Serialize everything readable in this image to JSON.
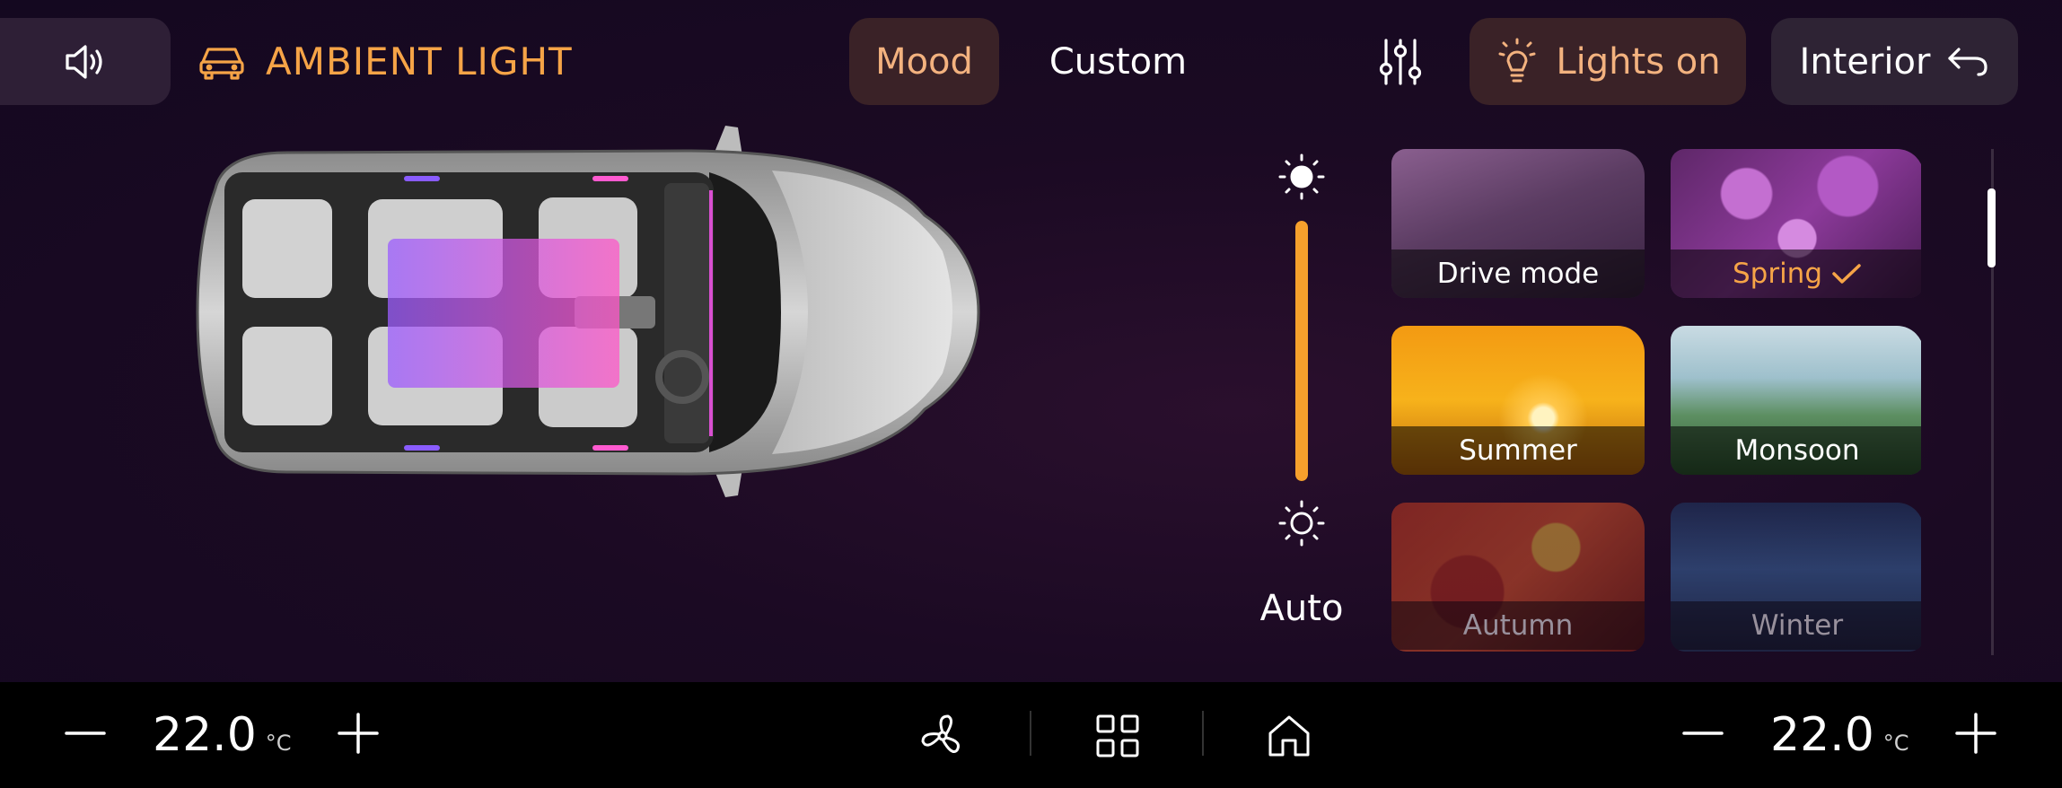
{
  "header": {
    "title": "AMBIENT LIGHT",
    "tabs": [
      {
        "label": "Mood",
        "selected": true
      },
      {
        "label": "Custom",
        "selected": false
      }
    ],
    "lights_label": "Lights on",
    "interior_label": "Interior"
  },
  "brightness": {
    "auto_label": "Auto",
    "level": 1.0
  },
  "moods": [
    {
      "label": "Drive mode",
      "selected": false
    },
    {
      "label": "Spring",
      "selected": true
    },
    {
      "label": "Summer",
      "selected": false
    },
    {
      "label": "Monsoon",
      "selected": false
    },
    {
      "label": "Autumn",
      "selected": false
    },
    {
      "label": "Winter",
      "selected": false
    }
  ],
  "climate": {
    "left_temp": "22.0",
    "right_temp": "22.0",
    "unit": "°C"
  },
  "colors": {
    "accent": "#f6a447",
    "selected_bg": "#3a2227",
    "background": "#1b0a23"
  },
  "icons": {
    "volume": "volume-icon",
    "car": "car-icon",
    "sliders": "sliders-icon",
    "bulb": "bulb-icon",
    "back": "back-arrow-icon",
    "fan": "fan-icon",
    "apps": "apps-grid-icon",
    "home": "home-icon"
  }
}
